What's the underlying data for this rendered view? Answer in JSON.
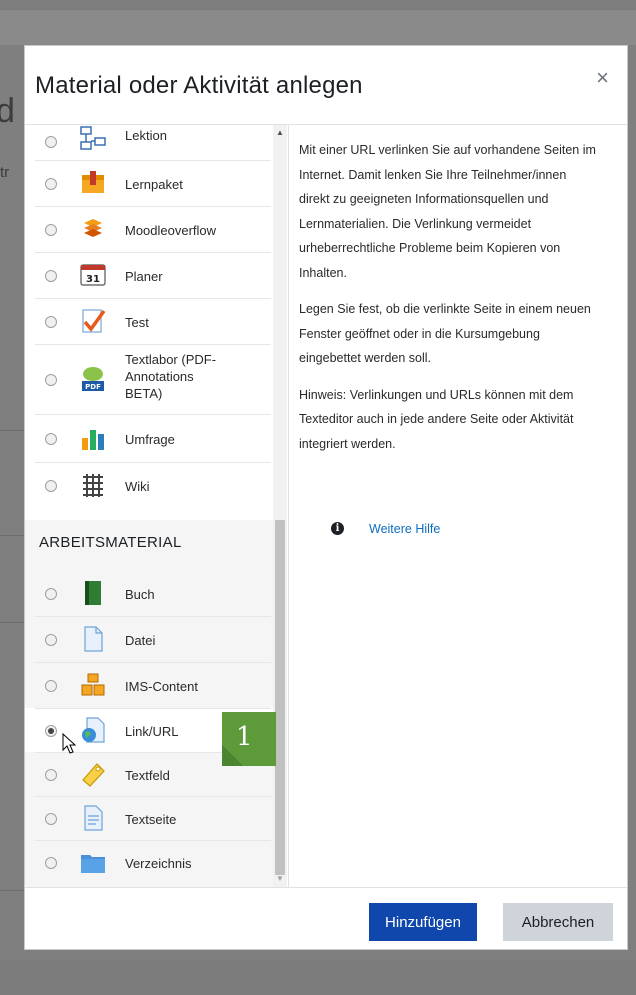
{
  "background": {
    "partial_heading": "d",
    "partial_text": "tr"
  },
  "dialog": {
    "title": "Material oder Aktivität anlegen",
    "close_symbol": "×"
  },
  "activities": [
    {
      "label": "Lektion",
      "icon": "lesson-icon",
      "selected": false
    },
    {
      "label": "Lernpaket",
      "icon": "scorm-package-icon",
      "selected": false
    },
    {
      "label": "Moodleoverflow",
      "icon": "moodleoverflow-icon",
      "selected": false
    },
    {
      "label": "Planer",
      "icon": "planner-calendar-icon",
      "icon_text": "31",
      "selected": false
    },
    {
      "label": "Test",
      "icon": "quiz-check-icon",
      "selected": false
    },
    {
      "label": "Textlabor (PDF-Annotations BETA)",
      "label_lines": [
        "Textlabor (PDF-",
        "Annotations",
        "BETA)"
      ],
      "icon": "pdf-annotation-icon",
      "icon_text": "PDF",
      "selected": false
    },
    {
      "label": "Umfrage",
      "icon": "survey-chart-icon",
      "selected": false
    },
    {
      "label": "Wiki",
      "icon": "wiki-icon",
      "selected": false
    }
  ],
  "resources_header": "ARBEITSMATERIAL",
  "resources": [
    {
      "label": "Buch",
      "icon": "book-icon",
      "selected": false
    },
    {
      "label": "Datei",
      "icon": "file-icon",
      "selected": false
    },
    {
      "label": "IMS-Content",
      "icon": "ims-package-icon",
      "selected": false
    },
    {
      "label": "Link/URL",
      "icon": "url-globe-icon",
      "selected": true
    },
    {
      "label": "Textfeld",
      "icon": "label-tag-icon",
      "selected": false
    },
    {
      "label": "Textseite",
      "icon": "page-icon",
      "selected": false
    },
    {
      "label": "Verzeichnis",
      "icon": "folder-icon",
      "selected": false
    }
  ],
  "description": {
    "paragraphs": [
      "Mit einer URL verlinken Sie auf vorhandene Seiten im Internet. Damit lenken Sie Ihre Teilnehmer/innen direkt zu geeigneten Informationsquellen und Lernmaterialien. Die Verlinkung vermeidet urheberrechtliche Probleme beim Kopieren von Inhalten.",
      "Legen Sie fest, ob die verlinkte Seite in einem neuen Fenster geöffnet oder in die Kursumgebung eingebettet werden soll.",
      "Hinweis: Verlinkungen und URLs können mit dem Texteditor auch in jede andere Seite oder Aktivität integriert werden."
    ],
    "help_link": "Weitere Hilfe",
    "help_icon": "info-icon"
  },
  "footer": {
    "add_label": "Hinzufügen",
    "cancel_label": "Abbrechen"
  },
  "annotation": {
    "step_number": "1",
    "color": "#5d9b3a"
  },
  "colors": {
    "primary_button": "#0f47ad",
    "secondary_button": "#ced4da",
    "link": "#0f6cbf"
  }
}
